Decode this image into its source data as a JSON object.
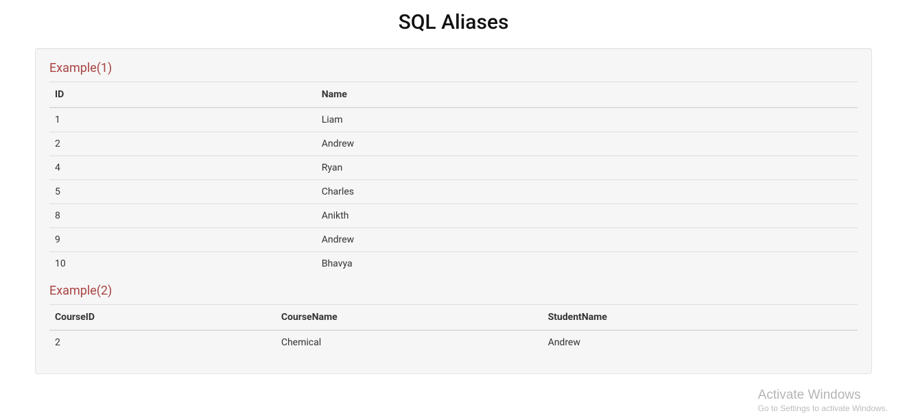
{
  "title": "SQL Aliases",
  "example1": {
    "heading": "Example(1)",
    "headers": [
      "ID",
      "Name"
    ],
    "rows": [
      {
        "id": "1",
        "name": "Liam"
      },
      {
        "id": "2",
        "name": "Andrew"
      },
      {
        "id": "4",
        "name": "Ryan"
      },
      {
        "id": "5",
        "name": "Charles"
      },
      {
        "id": "8",
        "name": "Anikth"
      },
      {
        "id": "9",
        "name": "Andrew"
      },
      {
        "id": "10",
        "name": "Bhavya"
      }
    ]
  },
  "example2": {
    "heading": "Example(2)",
    "headers": [
      "CourseID",
      "CourseName",
      "StudentName"
    ],
    "rows": [
      {
        "courseId": "2",
        "courseName": "Chemical",
        "studentName": "Andrew"
      }
    ]
  },
  "watermark": {
    "title": "Activate Windows",
    "sub": "Go to Settings to activate Windows."
  }
}
